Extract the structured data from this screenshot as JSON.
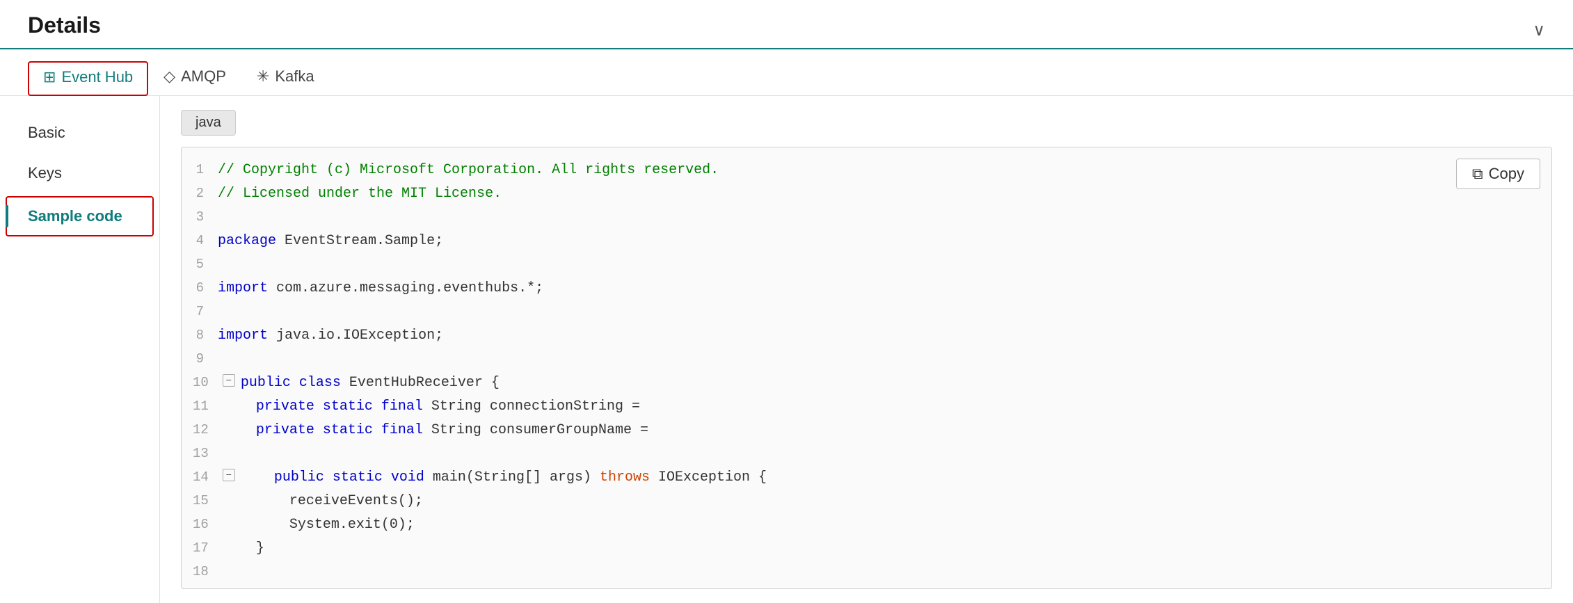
{
  "header": {
    "title": "Details",
    "chevron": "∨"
  },
  "tabs": [
    {
      "id": "event-hub",
      "label": "Event Hub",
      "icon": "⊞",
      "active": true
    },
    {
      "id": "amqp",
      "label": "AMQP",
      "icon": "◇"
    },
    {
      "id": "kafka",
      "label": "Kafka",
      "icon": "✳"
    }
  ],
  "sidebar": {
    "items": [
      {
        "id": "basic",
        "label": "Basic",
        "active": false
      },
      {
        "id": "keys",
        "label": "Keys",
        "active": false
      },
      {
        "id": "sample-code",
        "label": "Sample code",
        "active": true
      }
    ]
  },
  "code": {
    "language": "java",
    "copy_label": "Copy",
    "lines": [
      {
        "num": 1,
        "content": "// Copyright (c) Microsoft Corporation. All rights reserved.",
        "type": "comment"
      },
      {
        "num": 2,
        "content": "// Licensed under the MIT License.",
        "type": "comment"
      },
      {
        "num": 3,
        "content": "",
        "type": "plain"
      },
      {
        "num": 4,
        "content": "package EventStream.Sample;",
        "type": "package"
      },
      {
        "num": 5,
        "content": "",
        "type": "plain"
      },
      {
        "num": 6,
        "content": "import com.azure.messaging.eventhubs.*;",
        "type": "import"
      },
      {
        "num": 7,
        "content": "",
        "type": "plain"
      },
      {
        "num": 8,
        "content": "import java.io.IOException;",
        "type": "import"
      },
      {
        "num": 9,
        "content": "",
        "type": "plain"
      },
      {
        "num": 10,
        "content": "public class EventHubReceiver {",
        "type": "class",
        "foldable": true
      },
      {
        "num": 11,
        "content": "    private static final String connectionString =",
        "type": "field"
      },
      {
        "num": 12,
        "content": "    private static final String consumerGroupName =",
        "type": "field"
      },
      {
        "num": 13,
        "content": "",
        "type": "plain"
      },
      {
        "num": 14,
        "content": "    public static void main(String[] args) throws IOException {",
        "type": "method",
        "foldable": true
      },
      {
        "num": 15,
        "content": "        receiveEvents();",
        "type": "plain"
      },
      {
        "num": 16,
        "content": "        System.exit(0);",
        "type": "plain"
      },
      {
        "num": 17,
        "content": "    }",
        "type": "plain"
      },
      {
        "num": 18,
        "content": "",
        "type": "plain"
      }
    ]
  }
}
